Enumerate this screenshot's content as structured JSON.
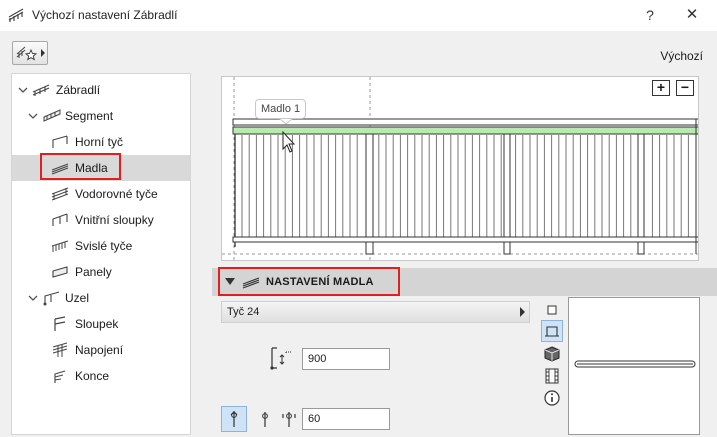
{
  "window": {
    "title": "Výchozí nastavení Zábradlí",
    "help_label": "?",
    "close_label": "✕"
  },
  "toolbar": {
    "default_label": "Výchozí"
  },
  "tree": {
    "items": [
      {
        "label": "Zábradlí",
        "level": 0,
        "expanded": true,
        "icon": "railing-icon"
      },
      {
        "label": "Segment",
        "level": 1,
        "expanded": true,
        "icon": "segment-icon"
      },
      {
        "label": "Horní tyč",
        "level": 2,
        "icon": "top-rail-icon"
      },
      {
        "label": "Madla",
        "level": 2,
        "icon": "handrail-icon",
        "selected": true
      },
      {
        "label": "Vodorovné tyče",
        "level": 2,
        "icon": "horizontal-rails-icon"
      },
      {
        "label": "Vnitřní sloupky",
        "level": 2,
        "icon": "inner-posts-icon"
      },
      {
        "label": "Svislé tyče",
        "level": 2,
        "icon": "balusters-icon"
      },
      {
        "label": "Panely",
        "level": 2,
        "icon": "panels-icon"
      },
      {
        "label": "Uzel",
        "level": 1,
        "expanded": true,
        "icon": "node-icon"
      },
      {
        "label": "Sloupek",
        "level": 2,
        "icon": "post-icon"
      },
      {
        "label": "Napojení",
        "level": 2,
        "icon": "connection-icon"
      },
      {
        "label": "Konce",
        "level": 2,
        "icon": "ends-icon"
      }
    ]
  },
  "preview": {
    "callout_label": "Madlo 1",
    "zoom_in_label": "+",
    "zoom_out_label": "−",
    "highlight_color": "#b8eab0"
  },
  "section": {
    "title": "NASTAVENÍ MADLA"
  },
  "settings": {
    "profile_value": "Tyč 24",
    "height_value": "900",
    "offset_value": "60"
  },
  "colors": {
    "accent_red": "#e02020",
    "selection_bg": "#d9d9d9",
    "header_bg": "#d4d4d4"
  }
}
